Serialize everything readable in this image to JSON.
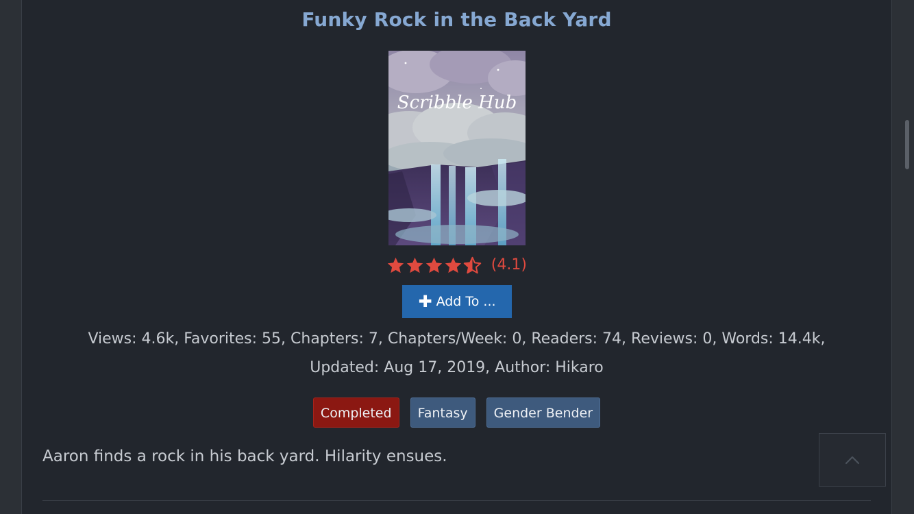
{
  "novel": {
    "title": "Funky Rock in the Back Yard",
    "cover_text": "Scribble Hub",
    "rating": {
      "stars": 4.1,
      "max_stars": 5,
      "label": "(4.1)"
    },
    "add_button_label": "Add To ...",
    "stats": {
      "line1": "Views: 4.6k, Favorites: 55, Chapters: 7, Chapters/Week: 0, Readers: 74, Reviews: 0, Words: 14.4k,",
      "line2": "Updated: Aug 17, 2019, Author: Hikaro"
    },
    "tags": [
      {
        "label": "Completed",
        "kind": "status"
      },
      {
        "label": "Fantasy",
        "kind": "genre"
      },
      {
        "label": "Gender Bender",
        "kind": "genre"
      }
    ],
    "synopsis": "Aaron finds a rock in his back yard. Hilarity ensues."
  },
  "icons": {
    "add": "plus-icon",
    "scroll_top": "chevron-up-icon",
    "star": "star-icon"
  },
  "colors": {
    "title": "#86a8d2",
    "star": "#e04a3f",
    "button": "#2467ad",
    "status_tag": "#8b1812",
    "genre_tag": "#3e5a7d"
  }
}
